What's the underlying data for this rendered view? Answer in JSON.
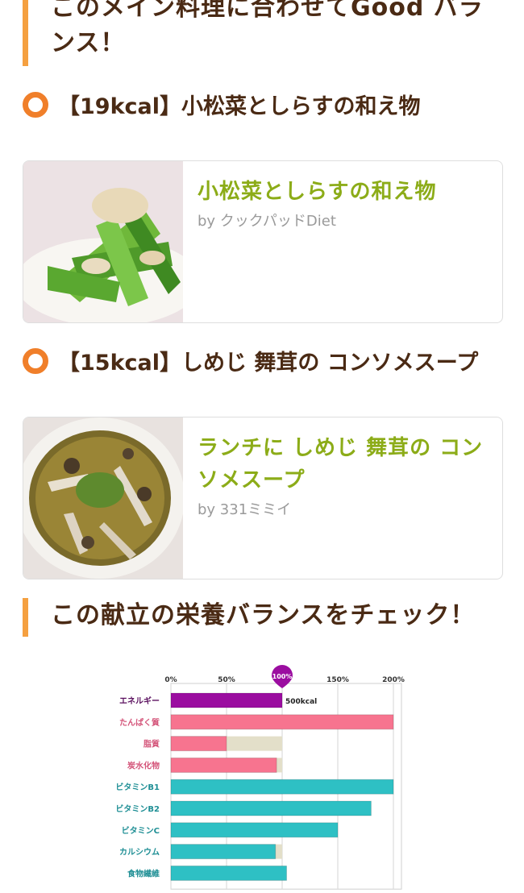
{
  "sections": {
    "balance_heading": "このメイン料理に合わせてGood バランス！",
    "nutrition_heading": "この献立の栄養バランスをチェック！"
  },
  "recipes": [
    {
      "heading": "【19kcal】小松菜としらすの和え物",
      "title": "小松菜としらすの和え物",
      "by": "by クックパッドDiet"
    },
    {
      "heading": "【15kcal】しめじ 舞茸の コンソメスープ",
      "title": "ランチに しめじ 舞茸の コンソメスープ",
      "by": "by 331ミミイ"
    }
  ],
  "colors": {
    "accent_orange": "#f07f2a",
    "section_bar": "#f5a040",
    "title_green": "#8cac18",
    "energy": "#9b0da0",
    "protein_group": "#f7748f",
    "vitamin_group": "#2ec0c4",
    "target_bar": "#e3dfc9"
  },
  "chart_data": {
    "type": "bar",
    "orientation": "horizontal",
    "x_tick_labels": [
      "0%",
      "50%",
      "100%",
      "150%",
      "200%"
    ],
    "xlim": [
      0,
      200
    ],
    "target_marker": "100%",
    "energy_label": "500kcal",
    "categories": [
      "エネルギー",
      "たんぱく質",
      "脂質",
      "炭水化物",
      "ビタミンB1",
      "ビタミンB2",
      "ビタミンC",
      "カルシウム",
      "食物繊維"
    ],
    "values": [
      100,
      200,
      50,
      95,
      200,
      180,
      150,
      94,
      104
    ],
    "grid": true
  }
}
